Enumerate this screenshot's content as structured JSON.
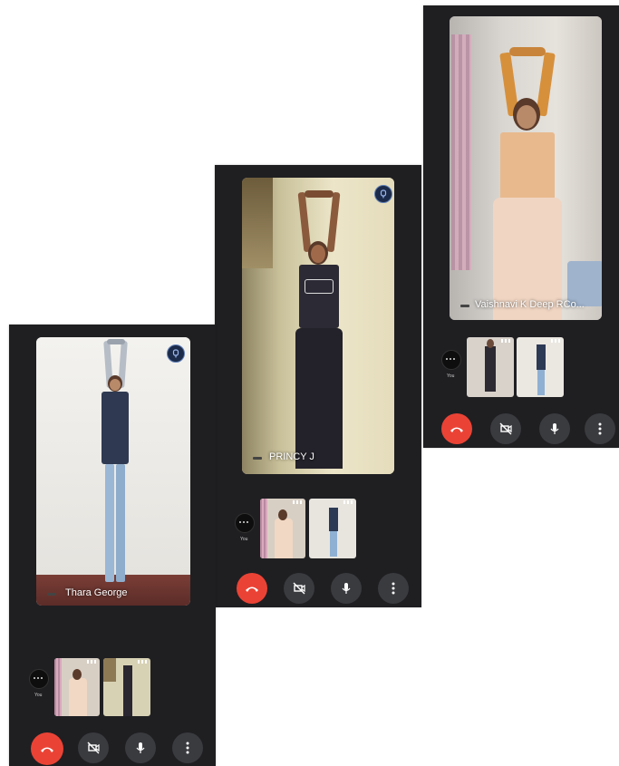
{
  "screens": [
    {
      "id": "screen-left",
      "participant_name": "Thara George",
      "self_label": "You",
      "icons": {
        "pin": "pin-icon",
        "end_call": "end-call-icon",
        "camera": "camera-off-icon",
        "mic": "microphone-icon",
        "more": "more-vert-icon"
      }
    },
    {
      "id": "screen-middle",
      "participant_name": "PRINCY J",
      "self_label": "You",
      "icons": {
        "pin": "pin-icon",
        "end_call": "end-call-icon",
        "camera": "camera-off-icon",
        "mic": "microphone-icon",
        "more": "more-vert-icon"
      }
    },
    {
      "id": "screen-right",
      "participant_name": "Vaishnavi K Deep RCo...",
      "self_label": "You",
      "icons": {
        "end_call": "end-call-icon",
        "camera": "camera-off-icon",
        "mic": "microphone-icon",
        "more": "more-vert-icon"
      }
    }
  ],
  "colors": {
    "app_background": "#1f1f22",
    "end_call": "#ea4335",
    "control_button": "#3a3b3f",
    "pin_badge": "#1c2b4a"
  }
}
